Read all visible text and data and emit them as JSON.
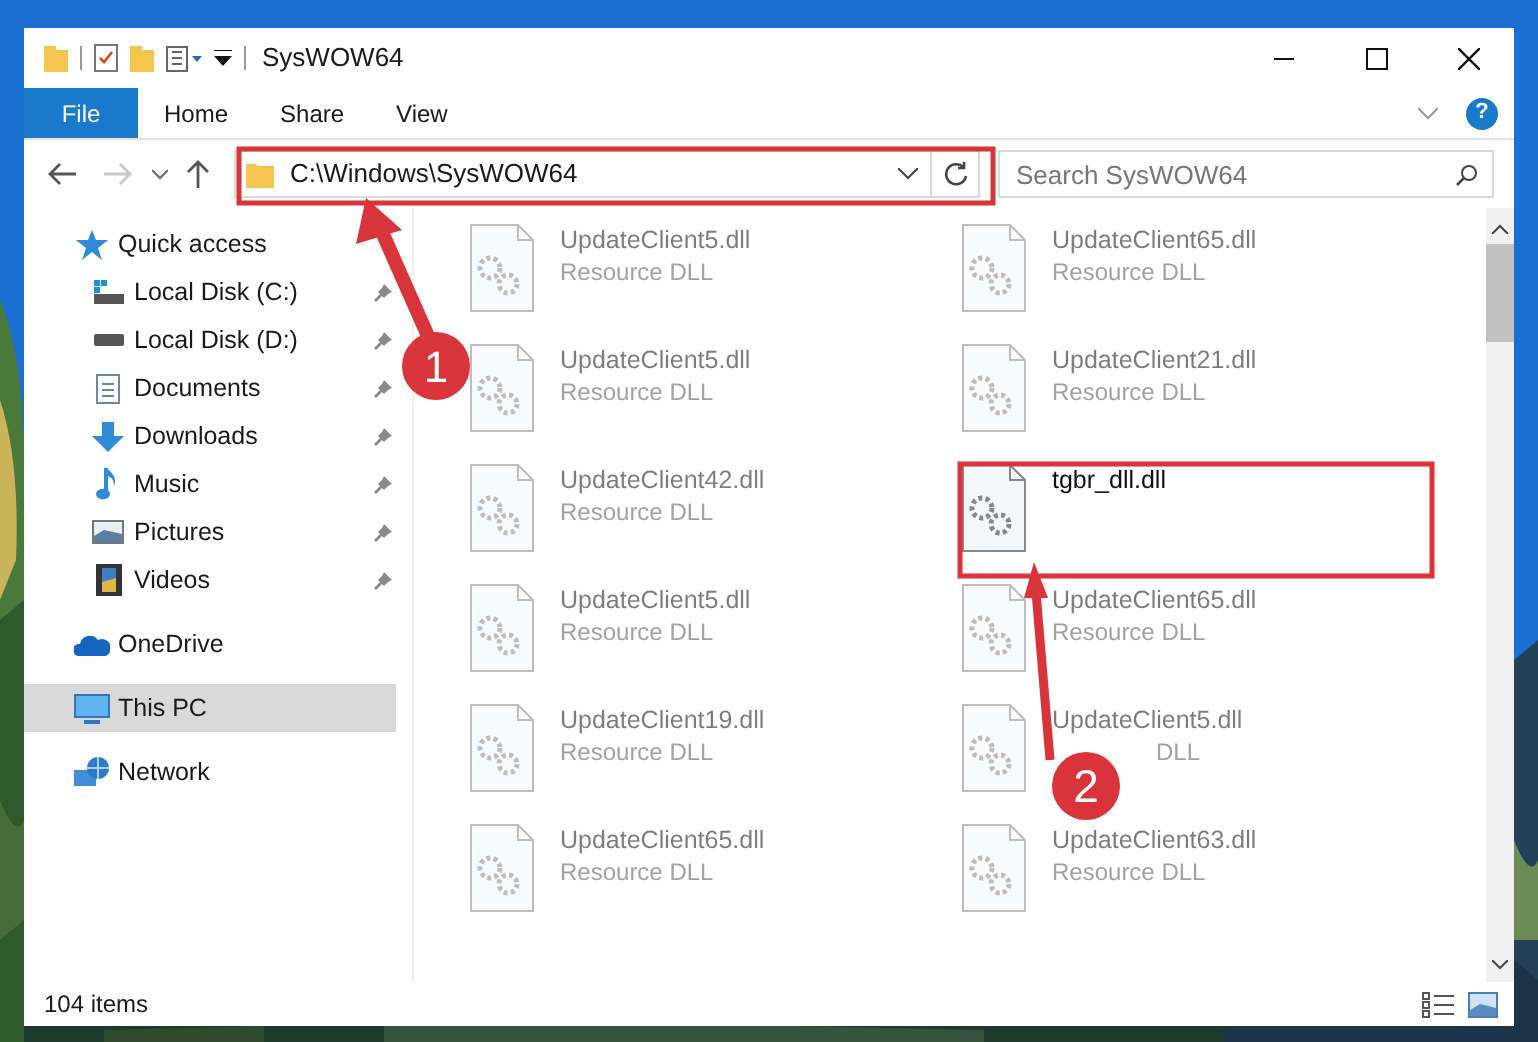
{
  "window": {
    "title": "SysWOW64"
  },
  "ribbon": {
    "file_button": "File",
    "tabs": [
      "Home",
      "Share",
      "View"
    ],
    "help_button": "?"
  },
  "navigation": {
    "forward_disabled": true
  },
  "address_bar": {
    "path": "C:\\Windows\\SysWOW64"
  },
  "search": {
    "placeholder": "Search SysWOW64"
  },
  "sidebar": {
    "items": [
      {
        "label": "Quick access",
        "kind": "quick",
        "selected": false,
        "children": [
          {
            "label": "Local Disk (C:)",
            "kind": "disk_c",
            "pinned": true,
            "selected": false
          },
          {
            "label": "Local Disk (D:)",
            "kind": "disk",
            "pinned": true,
            "selected": false
          },
          {
            "label": "Documents",
            "kind": "documents",
            "pinned": true,
            "selected": false
          },
          {
            "label": "Downloads",
            "kind": "downloads",
            "pinned": true,
            "selected": false
          },
          {
            "label": "Music",
            "kind": "music",
            "pinned": true,
            "selected": false
          },
          {
            "label": "Pictures",
            "kind": "pictures",
            "pinned": true,
            "selected": false
          },
          {
            "label": "Videos",
            "kind": "videos",
            "pinned": true,
            "selected": false
          }
        ]
      },
      {
        "label": "OneDrive",
        "kind": "onedrive",
        "selected": false
      },
      {
        "label": "This PC",
        "kind": "pc",
        "selected": true
      },
      {
        "label": "Network",
        "kind": "network",
        "selected": false
      }
    ]
  },
  "files": [
    {
      "name": "UpdateClient5.dll",
      "type": "Resource DLL",
      "dimmed": true
    },
    {
      "name": "UpdateClient65.dll",
      "type": "Resource DLL",
      "dimmed": true
    },
    {
      "name": "UpdateClient5.dll",
      "type": "Resource DLL",
      "dimmed": true
    },
    {
      "name": "UpdateClient21.dll",
      "type": "Resource DLL",
      "dimmed": true
    },
    {
      "name": "UpdateClient42.dll",
      "type": "Resource DLL",
      "dimmed": true
    },
    {
      "name": "tgbr_dll.dll",
      "dimmed": false
    },
    {
      "name": "UpdateClient5.dll",
      "type": "Resource DLL",
      "dimmed": true
    },
    {
      "name": "UpdateClient65.dll",
      "type": "Resource DLL",
      "dimmed": true
    },
    {
      "name": "UpdateClient19.dll",
      "type": "Resource DLL",
      "dimmed": true
    },
    {
      "name": "UpdateClient5.dll",
      "type": "DLL",
      "dimmed": true
    },
    {
      "name": "UpdateClient65.dll",
      "type": "Resource DLL",
      "dimmed": true
    },
    {
      "name": "UpdateClient63.dll",
      "type": "Resource DLL",
      "dimmed": true
    }
  ],
  "status_bar": {
    "item_count": "104 items"
  },
  "annotations": [
    {
      "label": "1"
    },
    {
      "label": "2"
    }
  ]
}
